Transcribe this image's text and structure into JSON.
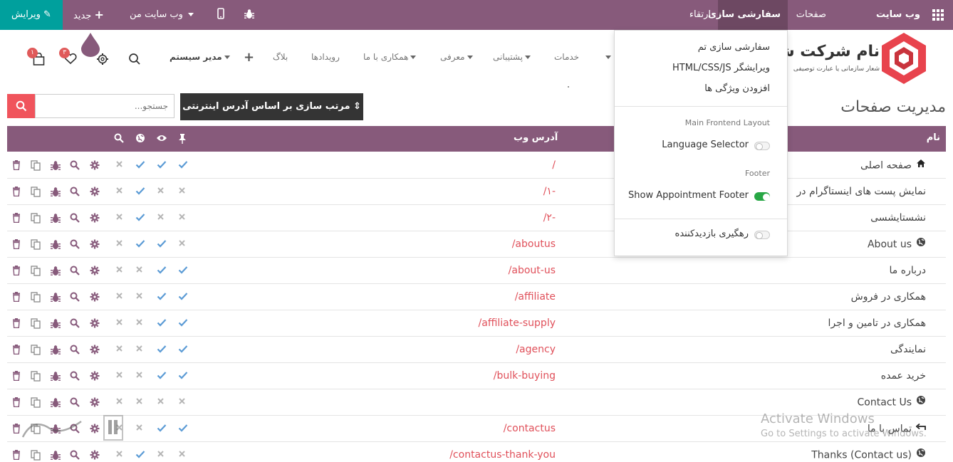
{
  "topbar": {
    "brand": "وب سایت",
    "pages": "صفحات",
    "customize": "سفارشی سازی",
    "upgrade": "ارتقاء",
    "my_website": "وب سایت من",
    "new": "جدید",
    "edit": "ویرایش"
  },
  "logo": {
    "name": "نام شرکت شما",
    "tagline": "شعار سازمانی یا عبارت توصیفی"
  },
  "navbar": {
    "links": [
      "بلاگ",
      "رویدادها",
      "همکاری با ما",
      "معرفی",
      "پشتیبانی",
      "خدمات"
    ],
    "admin": "مدیر سیستم",
    "cart_count": "۱",
    "wishlist_count": "۳"
  },
  "dropdown": {
    "theme": "سفارشی سازی تم",
    "editor": "HTML/CSS/JS ویرایشگر",
    "add_features": "افزودن ویژگی ها",
    "layout_header": "Main Frontend Layout",
    "language_selector": "Language Selector",
    "language_selector_on": false,
    "footer_header": "Footer",
    "appointment_footer": "Show Appointment Footer",
    "appointment_footer_on": true,
    "visitor_tracking": "رهگیری بازدیدکننده",
    "visitor_tracking_on": false
  },
  "page_title": "مدیریت صفحات",
  "search": {
    "placeholder": "جستجو..."
  },
  "sort_label": "مرتب سازی بر اساس آدرس اینترنتی",
  "table": {
    "col_name": "نام",
    "col_url": "آدرس وب",
    "rows": [
      {
        "name": "صفحه اصلی",
        "url": "/",
        "icon": "home-icon",
        "pin": true,
        "visible": true,
        "published": true
      },
      {
        "name": "نمایش پست های اینستاگرام در",
        "url": "/۱-",
        "icon": "",
        "pin": false,
        "visible": false,
        "published": true
      },
      {
        "name": "نشستایشسی",
        "url": "/۲-",
        "icon": "",
        "pin": false,
        "visible": false,
        "published": true
      },
      {
        "name": "About us",
        "url": "/aboutus",
        "icon": "globe-icon",
        "pin": false,
        "visible": true,
        "published": true
      },
      {
        "name": "درباره ما",
        "url": "/about-us",
        "icon": "",
        "pin": true,
        "visible": true,
        "published": false
      },
      {
        "name": "همکاری در فروش",
        "url": "/affiliate",
        "icon": "",
        "pin": true,
        "visible": true,
        "published": false
      },
      {
        "name": "همکاری در تامین و اجرا",
        "url": "/affiliate-supply",
        "icon": "",
        "pin": true,
        "visible": true,
        "published": false
      },
      {
        "name": "نمایندگی",
        "url": "/agency",
        "icon": "",
        "pin": true,
        "visible": true,
        "published": false
      },
      {
        "name": "خرید عمده",
        "url": "/bulk-buying",
        "icon": "",
        "pin": true,
        "visible": true,
        "published": false
      },
      {
        "name": "Contact Us",
        "url": "",
        "icon": "globe-icon",
        "pin": false,
        "visible": false,
        "published": false
      },
      {
        "name": "تماس با ما",
        "url": "/contactus",
        "icon": "redirect-icon",
        "pin": true,
        "visible": true,
        "published": false
      },
      {
        "name": "Thanks (Contact us)",
        "url": "/contactus-thank-you",
        "icon": "globe-icon",
        "pin": false,
        "visible": false,
        "published": true
      }
    ]
  },
  "watermark": {
    "line1": "Activate Windows",
    "line2": "Go to Settings to activate Windows."
  },
  "colors": {
    "topbar": "#875a7b",
    "edit": "#00a09d",
    "url": "#e0505a",
    "search_btn": "#f0545c",
    "sort_btn": "#343434",
    "check": "#5b9bd5"
  }
}
